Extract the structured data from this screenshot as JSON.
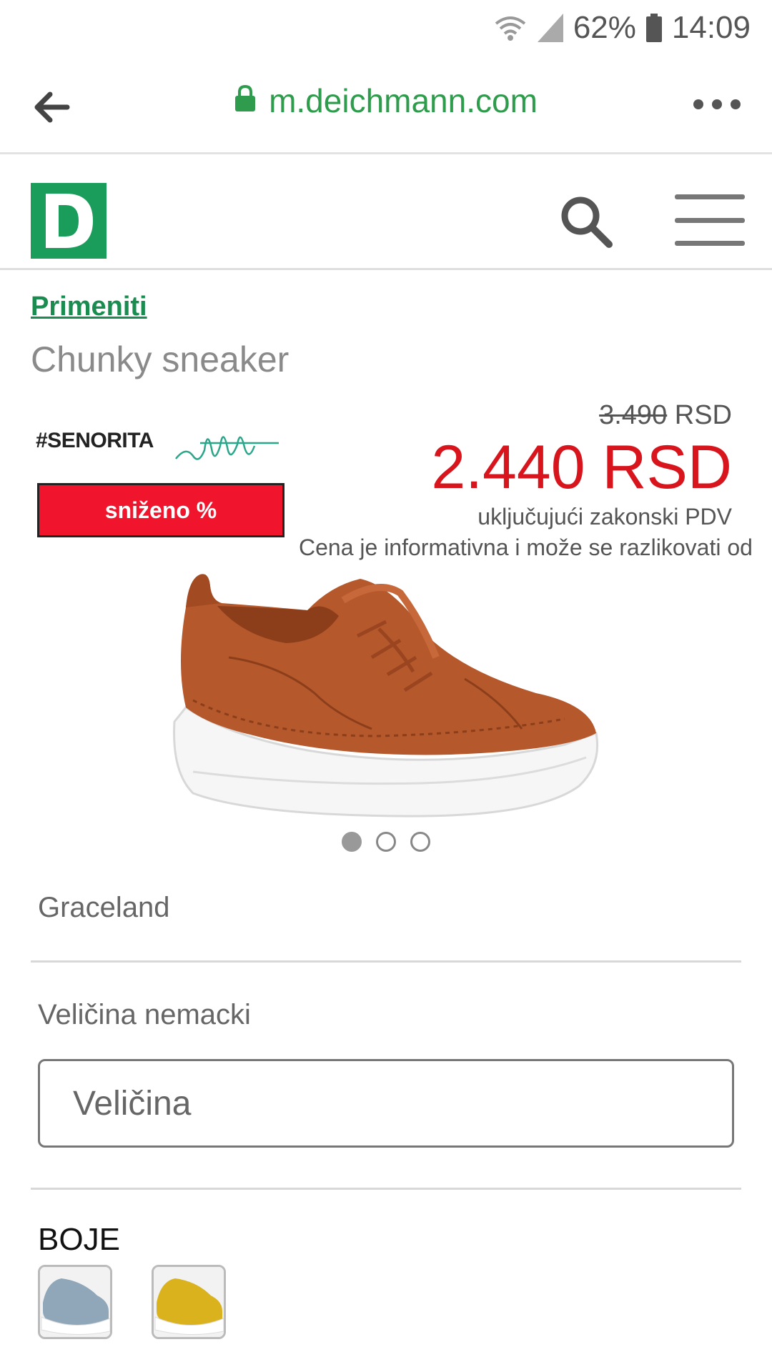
{
  "status_bar": {
    "battery": "62%",
    "time": "14:09"
  },
  "browser": {
    "url": "m.deichmann.com"
  },
  "site": {
    "logo_letter": "D"
  },
  "product": {
    "breadcrumb": "Primeniti",
    "title": "Chunky sneaker",
    "brand_logo_text": "#SENORITA",
    "sale_badge": "sniženo %",
    "old_price": "3.490",
    "old_price_currency": "RSD",
    "new_price": "2.440 RSD",
    "vat_note": "uključujući zakonski PDV",
    "disclaimer": "Cena je informativna i može se razlikovati od",
    "image_dots": {
      "count": 3,
      "active": 1
    },
    "brand": "Graceland",
    "size_label": "Veličina nemacki",
    "size_placeholder": "Veličina",
    "colors_label": "BOJE",
    "color_variants": [
      "light-blue",
      "yellow"
    ]
  },
  "colors": {
    "accent_green": "#1a9c5b",
    "url_green": "#2e9c4c",
    "sale_red": "#f0142c",
    "price_red": "#d8141c",
    "shoe_brown": "#b5582c"
  }
}
